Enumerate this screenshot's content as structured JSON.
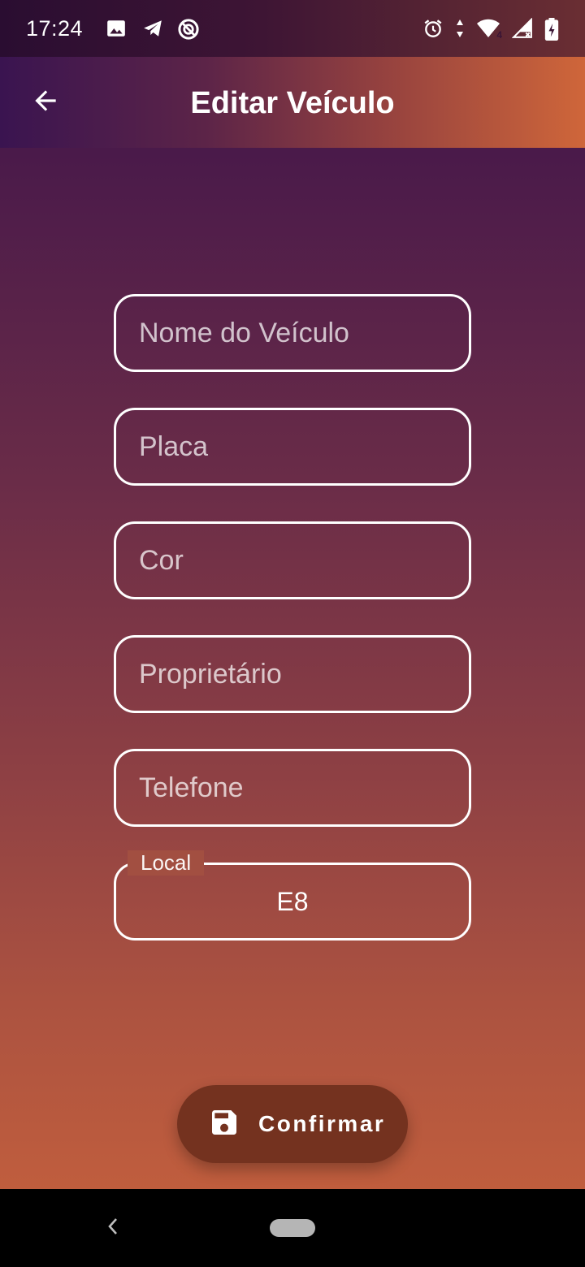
{
  "status_bar": {
    "time": "17:24",
    "left_icons": [
      "image-icon",
      "telegram-icon",
      "data-saver-icon"
    ],
    "right_icons": [
      "alarm-icon",
      "data-arrows-icon",
      "wifi-icon",
      "signal-icon",
      "battery-charging-icon"
    ],
    "wifi_badge": "4"
  },
  "app_bar": {
    "title": "Editar Veículo",
    "back_icon": "arrow-back-icon"
  },
  "form": {
    "fields": [
      {
        "placeholder": "Nome do Veículo",
        "value": ""
      },
      {
        "placeholder": "Placa",
        "value": ""
      },
      {
        "placeholder": "Cor",
        "value": ""
      },
      {
        "placeholder": "Proprietário",
        "value": ""
      },
      {
        "placeholder": "Telefone",
        "value": ""
      }
    ],
    "local": {
      "label": "Local",
      "value": "E8"
    }
  },
  "confirm_button": {
    "label": "Confirmar",
    "icon": "save-icon"
  },
  "nav_bar": {
    "back_icon": "nav-back-icon",
    "home_icon": "home-pill-icon"
  },
  "colors": {
    "gradient_top": "#3c1549",
    "gradient_bottom": "#c8623c",
    "button": "#74321f",
    "field_border": "#ffffff"
  }
}
